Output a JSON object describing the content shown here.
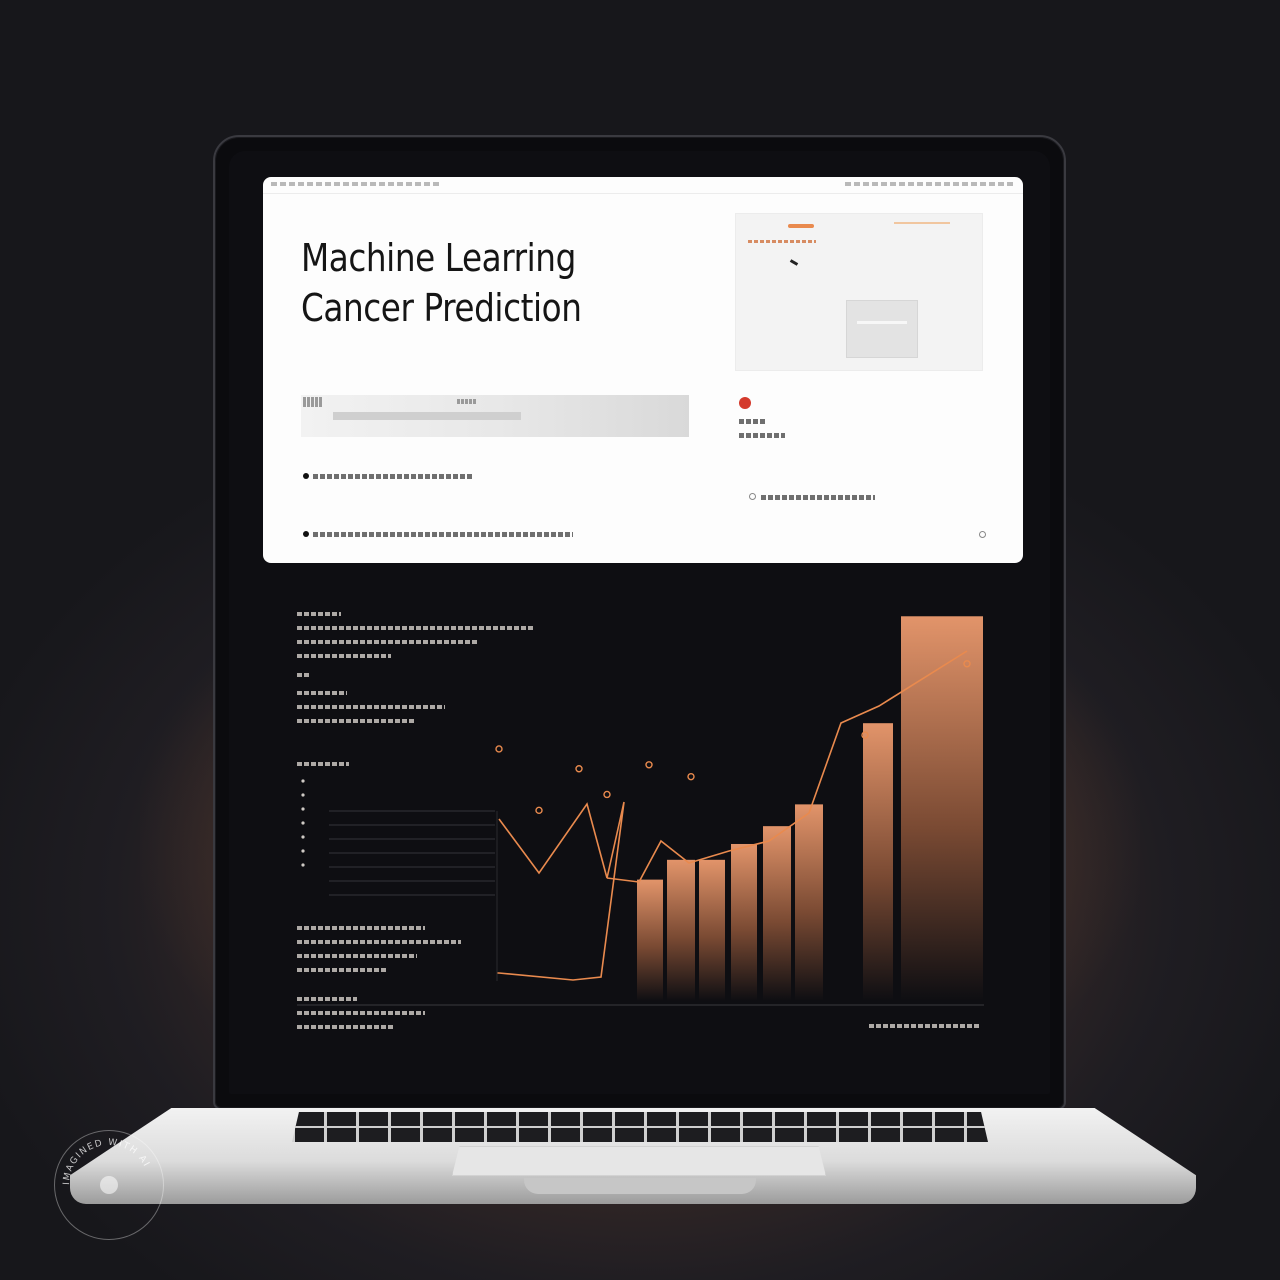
{
  "image": {
    "subject": "laptop",
    "watermark_text": "IMAGINED WITH AI"
  },
  "screen": {
    "title_line1": "Machine Learring",
    "title_line2": "Cancer Prediction"
  },
  "colors": {
    "accent": "#e98a4e",
    "bar_top": "#e2946a",
    "red_dot": "#d43a2c",
    "panel": "#fdfdfd",
    "screen_bg": "#0e0e12"
  },
  "chart_data": {
    "type": "bar",
    "series": [
      {
        "type": "bar",
        "values": [
          31,
          41,
          41,
          49,
          58,
          69,
          110,
          164
        ]
      },
      {
        "type": "line",
        "values": [
          97,
          66,
          87,
          74,
          89,
          83,
          104,
          140
        ]
      }
    ],
    "notes": "values are unlabeled relative heights read from the screen graphic"
  }
}
